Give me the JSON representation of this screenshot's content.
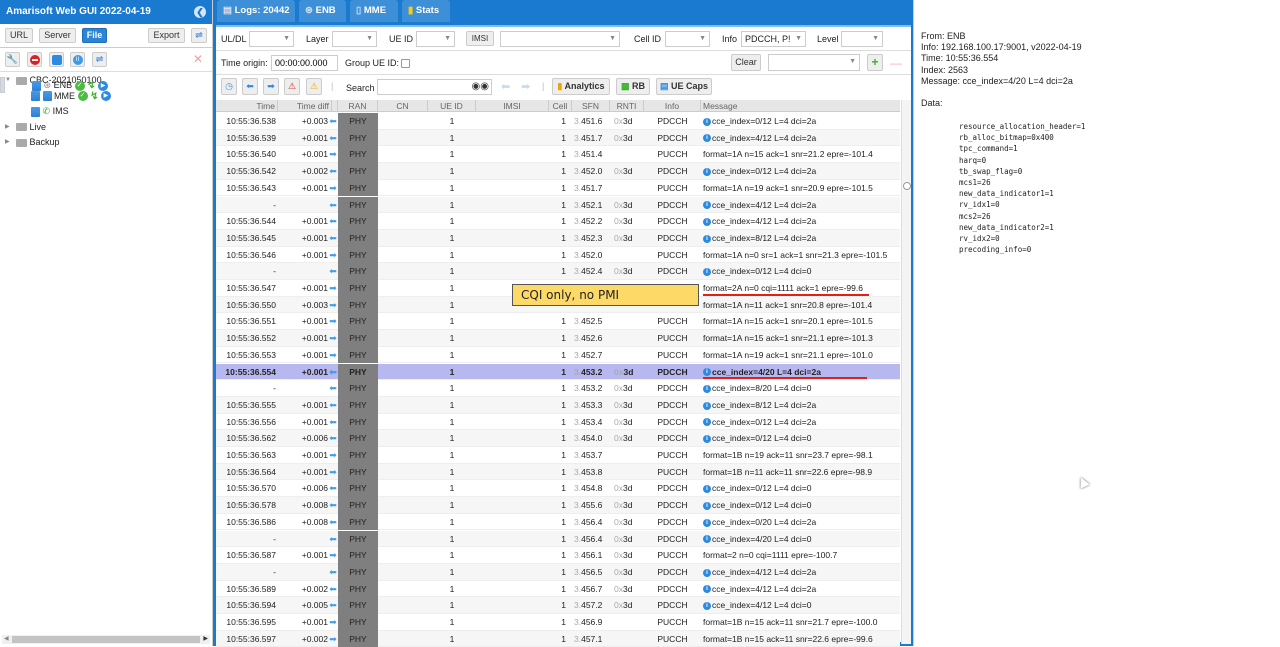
{
  "app": {
    "title": "Amarisoft Web GUI 2022-04-19"
  },
  "sidebar": {
    "buttons": {
      "url": "URL",
      "server": "Server",
      "file": "File",
      "export": "Export"
    },
    "tree": [
      {
        "label": "CBC-2021050100",
        "type": "folder",
        "expanded": true
      },
      {
        "label": "MME",
        "type": "node",
        "status": [
          "ok",
          "active",
          "play"
        ]
      },
      {
        "label": "ENB",
        "type": "node",
        "status": [
          "ok",
          "active",
          "play"
        ],
        "selected": true
      },
      {
        "label": "IMS",
        "type": "node"
      },
      {
        "label": "Live",
        "type": "folder",
        "expanded": false
      },
      {
        "label": "Backup",
        "type": "folder",
        "expanded": false
      }
    ]
  },
  "tabs": [
    {
      "label": "Logs: 20442",
      "icon": "document-icon"
    },
    {
      "label": "ENB",
      "icon": "antenna-icon"
    },
    {
      "label": "MME",
      "icon": "server-icon"
    },
    {
      "label": "Stats",
      "icon": "bar-chart-icon"
    }
  ],
  "filters": {
    "uldl": {
      "label": "UL/DL",
      "value": ""
    },
    "layer": {
      "label": "Layer",
      "value": ""
    },
    "ueid": {
      "label": "UE ID",
      "value": ""
    },
    "imsi": {
      "label": "IMSI",
      "value": ""
    },
    "cellid": {
      "label": "Cell ID",
      "value": ""
    },
    "info": {
      "label": "Info",
      "value": "PDCCH, P!"
    },
    "level": {
      "label": "Level",
      "value": ""
    },
    "time_origin": {
      "label": "Time origin:",
      "value": "00:00:00.000"
    },
    "group_ue": {
      "label": "Group UE ID:",
      "checked": false
    },
    "clear": "Clear",
    "search": {
      "label": "Search",
      "value": ""
    },
    "analytics": "Analytics",
    "rb": "RB",
    "uecaps": "UE Caps"
  },
  "table": {
    "columns": [
      "Time",
      "Time diff",
      "RAN",
      "CN",
      "UE ID",
      "IMSI",
      "Cell",
      "SFN",
      "RNTI",
      "Info",
      "Message"
    ],
    "rows": [
      {
        "time": "10:55:36.538",
        "diff": "+0.003",
        "dir": "dl",
        "ran": "PHY",
        "ue": "1",
        "cell": "1",
        "sfn": "451.6",
        "rnti": "3d",
        "info": "PDCCH",
        "msg": "cce_index=0/12 L=4 dci=2a",
        "i": true
      },
      {
        "time": "10:55:36.539",
        "diff": "+0.001",
        "dir": "dl",
        "ran": "PHY",
        "ue": "1",
        "cell": "1",
        "sfn": "451.7",
        "rnti": "3d",
        "info": "PDCCH",
        "msg": "cce_index=4/12 L=4 dci=2a",
        "i": true
      },
      {
        "time": "10:55:36.540",
        "diff": "+0.001",
        "dir": "ul",
        "ran": "PHY",
        "ue": "1",
        "cell": "1",
        "sfn": "451.4",
        "rnti": "",
        "info": "PUCCH",
        "msg": "format=1A n=15 ack=1 snr=21.2 epre=-101.4",
        "i": false
      },
      {
        "time": "10:55:36.542",
        "diff": "+0.002",
        "dir": "dl",
        "ran": "PHY",
        "ue": "1",
        "cell": "1",
        "sfn": "452.0",
        "rnti": "3d",
        "info": "PDCCH",
        "msg": "cce_index=0/12 L=4 dci=2a",
        "i": true
      },
      {
        "time": "10:55:36.543",
        "diff": "+0.001",
        "dir": "ul",
        "ran": "PHY",
        "ue": "1",
        "cell": "1",
        "sfn": "451.7",
        "rnti": "",
        "info": "PUCCH",
        "msg": "format=1A n=19 ack=1 snr=20.9 epre=-101.5",
        "i": false
      },
      {
        "time": "-",
        "diff": "",
        "dir": "dl",
        "ran": "PHY",
        "ue": "1",
        "cell": "1",
        "sfn": "452.1",
        "rnti": "3d",
        "info": "PDCCH",
        "msg": "cce_index=4/12 L=4 dci=2a",
        "i": true
      },
      {
        "time": "10:55:36.544",
        "diff": "+0.001",
        "dir": "dl",
        "ran": "PHY",
        "ue": "1",
        "cell": "1",
        "sfn": "452.2",
        "rnti": "3d",
        "info": "PDCCH",
        "msg": "cce_index=4/12 L=4 dci=2a",
        "i": true
      },
      {
        "time": "10:55:36.545",
        "diff": "+0.001",
        "dir": "dl",
        "ran": "PHY",
        "ue": "1",
        "cell": "1",
        "sfn": "452.3",
        "rnti": "3d",
        "info": "PDCCH",
        "msg": "cce_index=8/12 L=4 dci=2a",
        "i": true
      },
      {
        "time": "10:55:36.546",
        "diff": "+0.001",
        "dir": "ul",
        "ran": "PHY",
        "ue": "1",
        "cell": "1",
        "sfn": "452.0",
        "rnti": "",
        "info": "PUCCH",
        "msg": "format=1A n=0 sr=1 ack=1 snr=21.3 epre=-101.5",
        "i": false
      },
      {
        "time": "-",
        "diff": "",
        "dir": "dl",
        "ran": "PHY",
        "ue": "1",
        "cell": "1",
        "sfn": "452.4",
        "rnti": "3d",
        "info": "PDCCH",
        "msg": "cce_index=0/12 L=4 dci=0",
        "i": true
      },
      {
        "time": "10:55:36.547",
        "diff": "+0.001",
        "dir": "ul",
        "ran": "PHY",
        "ue": "1",
        "cell": "",
        "sfn": "",
        "rnti": "",
        "info": "",
        "msg": "format=2A n=0 cqi=1111 ack=1 epre=-99.6",
        "i": false
      },
      {
        "time": "10:55:36.550",
        "diff": "+0.003",
        "dir": "ul",
        "ran": "PHY",
        "ue": "1",
        "cell": "",
        "sfn": "",
        "rnti": "",
        "info": "",
        "msg": "format=1A n=11 ack=1 snr=20.8 epre=-101.4",
        "i": false
      },
      {
        "time": "10:55:36.551",
        "diff": "+0.001",
        "dir": "ul",
        "ran": "PHY",
        "ue": "1",
        "cell": "1",
        "sfn": "452.5",
        "rnti": "",
        "info": "PUCCH",
        "msg": "format=1A n=15 ack=1 snr=20.1 epre=-101.5",
        "i": false
      },
      {
        "time": "10:55:36.552",
        "diff": "+0.001",
        "dir": "ul",
        "ran": "PHY",
        "ue": "1",
        "cell": "1",
        "sfn": "452.6",
        "rnti": "",
        "info": "PUCCH",
        "msg": "format=1A n=15 ack=1 snr=21.1 epre=-101.3",
        "i": false
      },
      {
        "time": "10:55:36.553",
        "diff": "+0.001",
        "dir": "ul",
        "ran": "PHY",
        "ue": "1",
        "cell": "1",
        "sfn": "452.7",
        "rnti": "",
        "info": "PUCCH",
        "msg": "format=1A n=19 ack=1 snr=21.1 epre=-101.0",
        "i": false
      },
      {
        "time": "10:55:36.554",
        "diff": "+0.001",
        "dir": "dl",
        "ran": "PHY",
        "ue": "1",
        "cell": "1",
        "sfn": "453.2",
        "rnti": "3d",
        "info": "PDCCH",
        "msg": "cce_index=4/20 L=4 dci=2a",
        "i": true,
        "selected": true
      },
      {
        "time": "-",
        "diff": "",
        "dir": "dl",
        "ran": "PHY",
        "ue": "1",
        "cell": "1",
        "sfn": "453.2",
        "rnti": "3d",
        "info": "PDCCH",
        "msg": "cce_index=8/20 L=4 dci=0",
        "i": true
      },
      {
        "time": "10:55:36.555",
        "diff": "+0.001",
        "dir": "dl",
        "ran": "PHY",
        "ue": "1",
        "cell": "1",
        "sfn": "453.3",
        "rnti": "3d",
        "info": "PDCCH",
        "msg": "cce_index=8/12 L=4 dci=2a",
        "i": true
      },
      {
        "time": "10:55:36.556",
        "diff": "+0.001",
        "dir": "dl",
        "ran": "PHY",
        "ue": "1",
        "cell": "1",
        "sfn": "453.4",
        "rnti": "3d",
        "info": "PDCCH",
        "msg": "cce_index=0/12 L=4 dci=2a",
        "i": true
      },
      {
        "time": "10:55:36.562",
        "diff": "+0.006",
        "dir": "dl",
        "ran": "PHY",
        "ue": "1",
        "cell": "1",
        "sfn": "454.0",
        "rnti": "3d",
        "info": "PDCCH",
        "msg": "cce_index=0/12 L=4 dci=0",
        "i": true
      },
      {
        "time": "10:55:36.563",
        "diff": "+0.001",
        "dir": "ul",
        "ran": "PHY",
        "ue": "1",
        "cell": "1",
        "sfn": "453.7",
        "rnti": "",
        "info": "PUCCH",
        "msg": "format=1B n=19 ack=11 snr=23.7 epre=-98.1",
        "i": false
      },
      {
        "time": "10:55:36.564",
        "diff": "+0.001",
        "dir": "ul",
        "ran": "PHY",
        "ue": "1",
        "cell": "1",
        "sfn": "453.8",
        "rnti": "",
        "info": "PUCCH",
        "msg": "format=1B n=11 ack=11 snr=22.6 epre=-98.9",
        "i": false
      },
      {
        "time": "10:55:36.570",
        "diff": "+0.006",
        "dir": "dl",
        "ran": "PHY",
        "ue": "1",
        "cell": "1",
        "sfn": "454.8",
        "rnti": "3d",
        "info": "PDCCH",
        "msg": "cce_index=0/12 L=4 dci=0",
        "i": true
      },
      {
        "time": "10:55:36.578",
        "diff": "+0.008",
        "dir": "dl",
        "ran": "PHY",
        "ue": "1",
        "cell": "1",
        "sfn": "455.6",
        "rnti": "3d",
        "info": "PDCCH",
        "msg": "cce_index=0/12 L=4 dci=0",
        "i": true
      },
      {
        "time": "10:55:36.586",
        "diff": "+0.008",
        "dir": "dl",
        "ran": "PHY",
        "ue": "1",
        "cell": "1",
        "sfn": "456.4",
        "rnti": "3d",
        "info": "PDCCH",
        "msg": "cce_index=0/20 L=4 dci=2a",
        "i": true
      },
      {
        "time": "-",
        "diff": "",
        "dir": "dl",
        "ran": "PHY",
        "ue": "1",
        "cell": "1",
        "sfn": "456.4",
        "rnti": "3d",
        "info": "PDCCH",
        "msg": "cce_index=4/20 L=4 dci=0",
        "i": true
      },
      {
        "time": "10:55:36.587",
        "diff": "+0.001",
        "dir": "ul",
        "ran": "PHY",
        "ue": "1",
        "cell": "1",
        "sfn": "456.1",
        "rnti": "3d",
        "info": "PUCCH",
        "msg": "format=2 n=0 cqi=1111 epre=-100.7",
        "i": false
      },
      {
        "time": "-",
        "diff": "",
        "dir": "dl",
        "ran": "PHY",
        "ue": "1",
        "cell": "1",
        "sfn": "456.5",
        "rnti": "3d",
        "info": "PDCCH",
        "msg": "cce_index=4/12 L=4 dci=2a",
        "i": true
      },
      {
        "time": "10:55:36.589",
        "diff": "+0.002",
        "dir": "dl",
        "ran": "PHY",
        "ue": "1",
        "cell": "1",
        "sfn": "456.7",
        "rnti": "3d",
        "info": "PDCCH",
        "msg": "cce_index=4/12 L=4 dci=2a",
        "i": true
      },
      {
        "time": "10:55:36.594",
        "diff": "+0.005",
        "dir": "dl",
        "ran": "PHY",
        "ue": "1",
        "cell": "1",
        "sfn": "457.2",
        "rnti": "3d",
        "info": "PDCCH",
        "msg": "cce_index=4/12 L=4 dci=0",
        "i": true
      },
      {
        "time": "10:55:36.595",
        "diff": "+0.001",
        "dir": "ul",
        "ran": "PHY",
        "ue": "1",
        "cell": "1",
        "sfn": "456.9",
        "rnti": "",
        "info": "PUCCH",
        "msg": "format=1B n=15 ack=11 snr=21.7 epre=-100.0",
        "i": false
      },
      {
        "time": "10:55:36.597",
        "diff": "+0.002",
        "dir": "ul",
        "ran": "PHY",
        "ue": "1",
        "cell": "1",
        "sfn": "457.1",
        "rnti": "",
        "info": "PUCCH",
        "msg": "format=1B n=15 ack=11 snr=22.6 epre=-99.6",
        "i": false
      }
    ]
  },
  "sfn_prefix": "3.",
  "rnti_prefix": "0x",
  "annotation": {
    "text": "CQI only, no PMI"
  },
  "detail": {
    "from": "From: ENB",
    "info": "Info: 192.168.100.17:9001, v2022-04-19",
    "time": "Time: 10:55:36.554",
    "index": "Index: 2563",
    "message": "Message: cce_index=4/20 L=4 dci=2a",
    "data_label": "Data:",
    "data": "resource_allocation_header=1\nrb_alloc_bitmap=0x400\ntpc_command=1\nharq=0\ntb_swap_flag=0\nmcs1=26\nnew_data_indicator1=1\nrv_idx1=0\nmcs2=26\nnew_data_indicator2=1\nrv_idx2=0\nprecoding_info=0"
  },
  "colors": {
    "brand": "#1a7ad0",
    "selected_row": "#b8b8f0",
    "annotation_bg": "#fdd968",
    "underline": "#e0201a"
  }
}
